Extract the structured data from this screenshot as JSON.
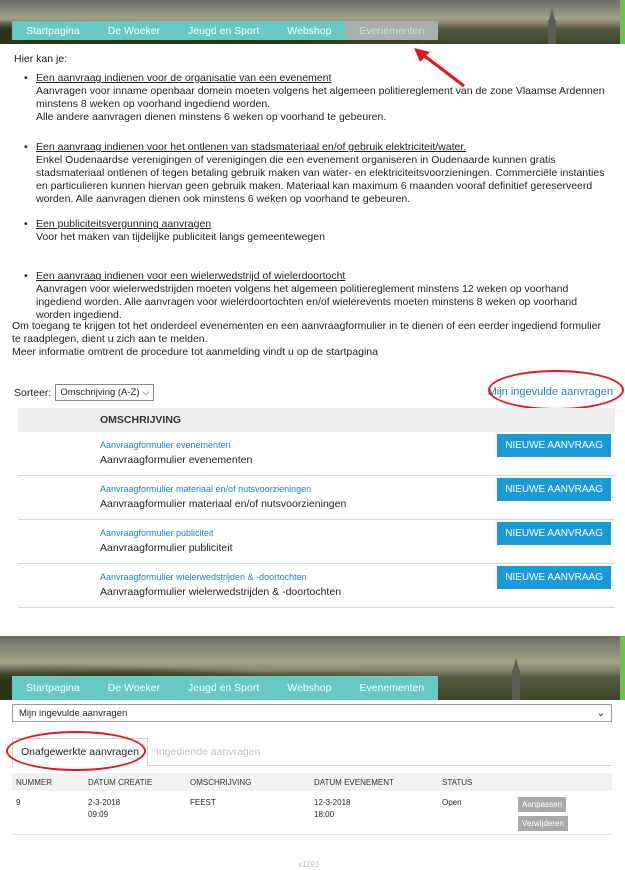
{
  "nav": {
    "items": [
      "Startpagina",
      "De Woeker",
      "Jeugd en Sport",
      "Webshop",
      "Evenementen"
    ],
    "active": "Evenementen"
  },
  "intro": "Hier kan je:",
  "bullets": [
    {
      "link": "Een aanvraag indienen voor de organisatie van een evenement",
      "text": "Aanvragen voor inname openbaar domein moeten volgens het algemeen politiereglement van de zone Vlaamse Ardennen minstens 8 weken op voorhand ingediend worden.\nAlle andere aanvragen dienen minstens 6 weken op voorhand te gebeuren."
    },
    {
      "link": "Een aanvraag indienen voor het ontlenen van stadsmateriaal en/of gebruik elektriciteit/water.",
      "text": "Enkel Oudenaardse verenigingen of verenigingen die een evenement organiseren in Oudenaarde kunnen gratis stadsmateriaal ontlenen of tegen betaling gebruik maken van water- en elektriciteitsvoorzieningen. Commerciële instanties en particulieren kunnen hiervan geen gebruik maken. Materiaal kan maximum 6 maanden vooraf definitief gereserveerd worden. Alle aanvragen dienen ook minstens 6 weken op voorhand te gebeuren."
    },
    {
      "link": "Een publiciteitsvergunning aanvragen",
      "text": "Voor het maken van tijdelijke publiciteit langs gemeentewegen"
    },
    {
      "link": "Een aanvraag indienen voor een wielerwedstrijd of wielerdoortocht",
      "text": "Aanvragen voor wielerwedstrijden moeten volgens het algemeen politiereglement minstens 12 weken op voorhand ingediend worden. Alle aanvragen voor wielerdoortochten en/of wielerevents moeten minstens 8 weken op voorhand worden ingediend."
    }
  ],
  "access_note": "Om toegang te krijgen tot het onderdeel evenementen en een aanvraagformulier in te dienen of een eerder ingediend formulier te raadplegen, dient u zich aan te melden.\nMeer informatie omtrent de procedure tot aanmelding vindt u op de startpagina",
  "sort": {
    "label": "Sorteer:",
    "value": "Omschrijving (A-Z)"
  },
  "mine_link": "Mijn ingevulde aanvragen",
  "forms_table": {
    "header": "OMSCHRIJVING",
    "button_label": "NIEUWE AANVRAAG",
    "rows": [
      {
        "link": "Aanvraagformulier evenementen",
        "desc": "Aanvraagformulier evenementen"
      },
      {
        "link": "Aanvraagformulier materiaal en/of nutsvoorzieningen",
        "desc": "Aanvraagformulier materiaal en/of nutsvoorzieningen"
      },
      {
        "link": "Aanvraagformulier publiciteit",
        "desc": "Aanvraagformulier publiciteit"
      },
      {
        "link": "Aanvraagformulier wielerwedstrijden & -doortochten",
        "desc": "Aanvraagformulier wielerwedstrijden & -doortochten"
      }
    ]
  },
  "second": {
    "dropdown_value": "Mijn ingevulde aanvragen",
    "tabs": [
      "Onafgewerkte aanvragen",
      "Ingediende aanvragen"
    ],
    "columns": [
      "NUMMER",
      "DATUM CREATIE",
      "OMSCHRIJVING",
      "DATUM EVENEMENT",
      "STATUS"
    ],
    "row": {
      "nummer": "9",
      "datum_creatie": "2-3-2018",
      "tijd_creatie": "09:09",
      "omschrijving": "FEEST",
      "datum_evenement": "12-3-2018",
      "tijd_evenement": "18:00",
      "status": "Open"
    },
    "edit_label": "Aanpassen",
    "delete_label": "Verwijderen"
  },
  "footer": "v1191",
  "colors": {
    "nav_bg": "#68c9c4",
    "nav_active": "#a8b0b2",
    "link": "#1f7fbf",
    "button": "#1a9bd8",
    "highlight": "#e0171d",
    "accent_edge": "#6cc24a"
  }
}
